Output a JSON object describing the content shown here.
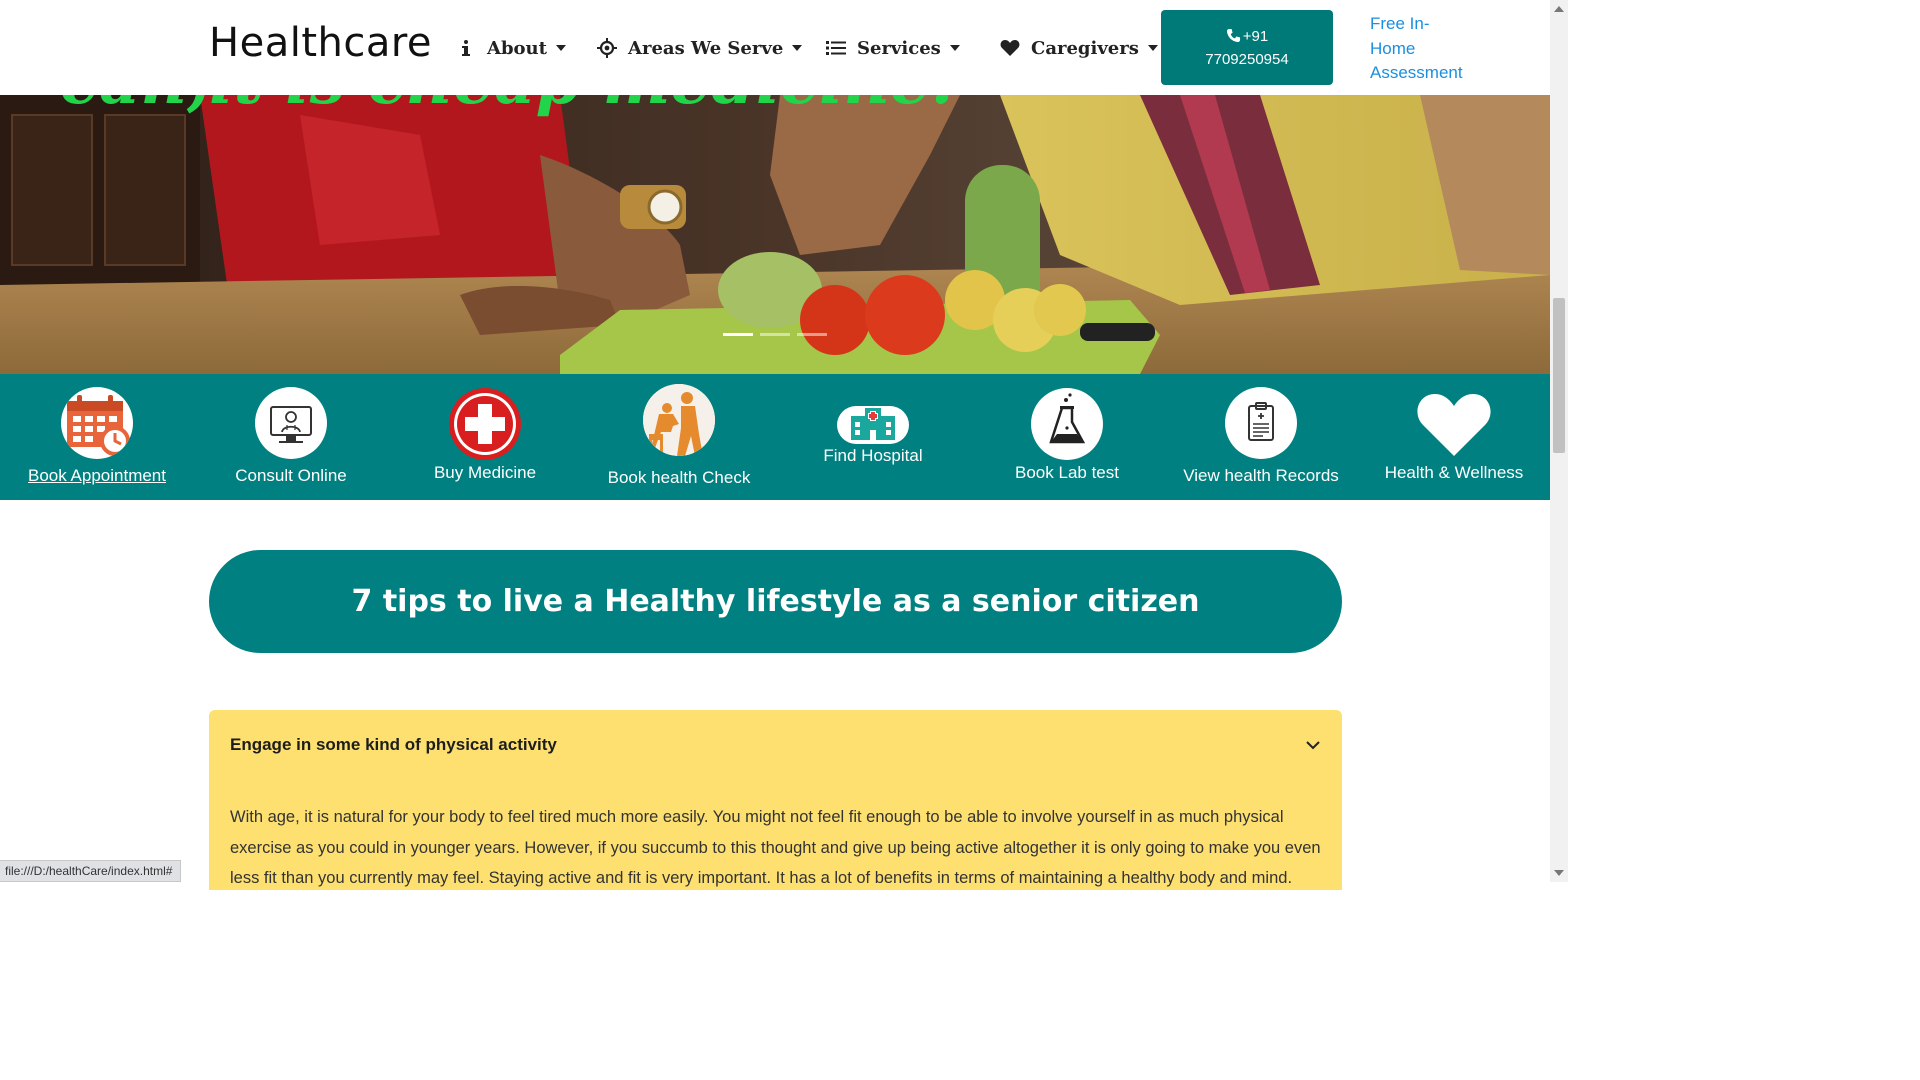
{
  "header": {
    "brand": "Healthcare",
    "nav": [
      {
        "label": "About",
        "icon": "info-icon"
      },
      {
        "label": "Areas We Serve",
        "icon": "crosshair-icon"
      },
      {
        "label": "Services",
        "icon": "list-icon"
      },
      {
        "label": "Caregivers",
        "icon": "heart-icon"
      }
    ],
    "phone_prefix": "+91",
    "phone_number": "7709250954",
    "assessment_link": "Free In-Home Assessment",
    "accent_color": "#007a78",
    "link_color": "#1a8fe0"
  },
  "hero": {
    "caption": "can,it is cheap medicine.",
    "caption_color": "#22d44a",
    "slides": 3,
    "active_slide": 1
  },
  "services": [
    {
      "label": "Book Appointment",
      "icon": "calendar-clock-icon"
    },
    {
      "label": "Consult Online",
      "icon": "doctor-monitor-icon"
    },
    {
      "label": "Buy Medicine",
      "icon": "red-cross-icon"
    },
    {
      "label": "Book health Check",
      "icon": "caregiver-elder-icon"
    },
    {
      "label": "Find Hospital",
      "icon": "hospital-building-icon"
    },
    {
      "label": "Book Lab test",
      "icon": "lab-flask-icon"
    },
    {
      "label": "View health Records",
      "icon": "clipboard-records-icon"
    },
    {
      "label": "Health & Wellness",
      "icon": "heart-icon"
    }
  ],
  "tips": {
    "heading": "7 tips to live a Healthy lifestyle as a senior citizen"
  },
  "accordion": {
    "title": "Engage in some kind of physical activity",
    "body": "With age, it is natural for your body to feel tired much more easily. You might not feel fit enough to be able to involve yourself in as much physical exercise as you could in younger years. However, if you succumb to this thought and give up being active altogether it is only going to make you even less fit than you currently may feel. Staying active and fit is very important. It has a lot of benefits in terms of maintaining a healthy body and mind.",
    "background": "#fde070"
  },
  "status_bar": {
    "url": "file:///D:/healthCare/index.html#"
  }
}
